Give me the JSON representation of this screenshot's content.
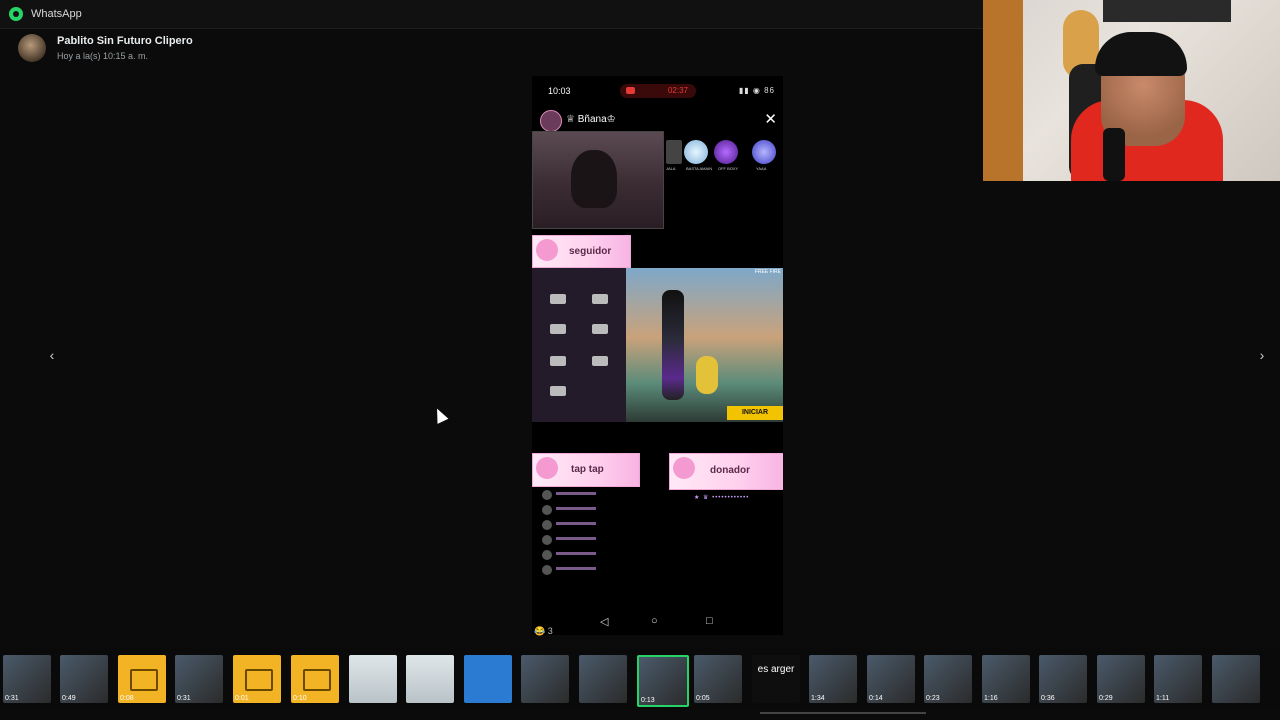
{
  "app": {
    "title": "WhatsApp"
  },
  "chat": {
    "contact_name": "Pablito Sin Futuro Clipero",
    "last_seen": "Hoy a la(s) 10:15 a. m."
  },
  "viewer": {
    "prev_label": "‹",
    "next_label": "›"
  },
  "phone": {
    "status_time": "10:03",
    "rec_timer": "02:37",
    "status_icons": "▮▮ ◉ 86",
    "host_name": "♕ Bñana♔",
    "close": "✕",
    "gift_captions": [
      "JALA",
      "BASTA AMAIN",
      "OFF BOXY",
      "YAAA"
    ],
    "banners": {
      "seguidor": "seguidor",
      "tap": "tap tap",
      "donador": "donador"
    },
    "game_start": "INICIAR",
    "game_corner": "FREE FIRE",
    "donator_line": "★ ♛ ••••••••••••",
    "nav": {
      "back": "◁",
      "home": "○",
      "recent": "□"
    }
  },
  "reaction": {
    "emoji": "😂",
    "count": "3"
  },
  "thumbnails": [
    {
      "type": "vid",
      "duration": "0:31"
    },
    {
      "type": "vid",
      "duration": "0:49"
    },
    {
      "type": "img",
      "duration": "0:08"
    },
    {
      "type": "vid",
      "duration": "0:31"
    },
    {
      "type": "img",
      "duration": "0:01"
    },
    {
      "type": "img",
      "duration": "0:10"
    },
    {
      "type": "doc",
      "duration": ""
    },
    {
      "type": "doc",
      "duration": ""
    },
    {
      "type": "blue",
      "duration": ""
    },
    {
      "type": "vid",
      "duration": ""
    },
    {
      "type": "vid",
      "duration": ""
    },
    {
      "type": "vid",
      "duration": "0:13",
      "selected": true
    },
    {
      "type": "vid",
      "duration": "0:05"
    },
    {
      "type": "text",
      "duration": "",
      "text": "es arger"
    },
    {
      "type": "vid",
      "duration": "1:34"
    },
    {
      "type": "vid",
      "duration": "0:14"
    },
    {
      "type": "vid",
      "duration": "0:23"
    },
    {
      "type": "vid",
      "duration": "1:16"
    },
    {
      "type": "vid",
      "duration": "0:36"
    },
    {
      "type": "vid",
      "duration": "0:29"
    },
    {
      "type": "vid",
      "duration": "1:11"
    },
    {
      "type": "vid",
      "duration": ""
    }
  ]
}
